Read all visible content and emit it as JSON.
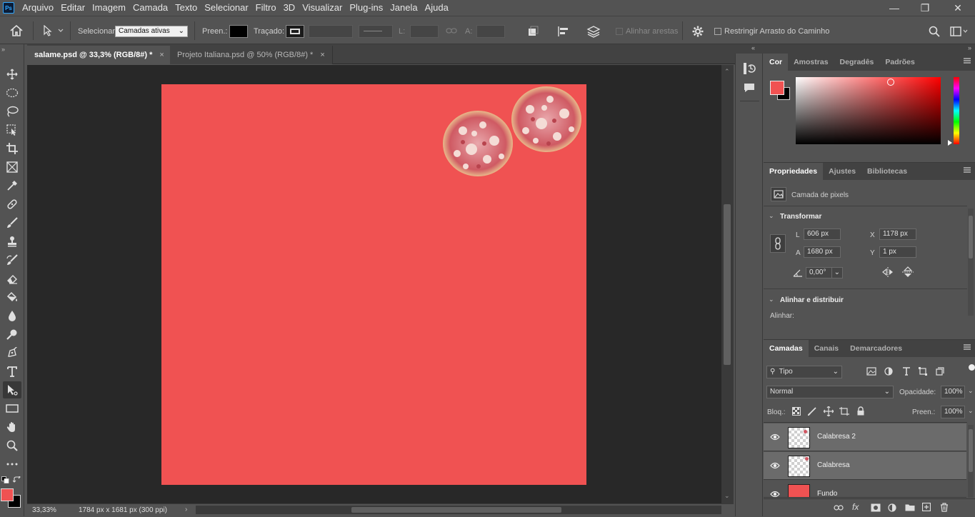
{
  "menubar": {
    "logo": "Ps",
    "items": [
      "Arquivo",
      "Editar",
      "Imagem",
      "Camada",
      "Texto",
      "Selecionar",
      "Filtro",
      "3D",
      "Visualizar",
      "Plug-ins",
      "Janela",
      "Ajuda"
    ]
  },
  "window": {
    "minimize": "—",
    "maximize": "❐",
    "close": "✕"
  },
  "options": {
    "select_label": "Selecionar:",
    "select_value": "Camadas ativas",
    "fill_label": "Preen.:",
    "stroke_label": "Traçado:",
    "width_label": "L:",
    "height_label": "A:",
    "align_edges": "Alinhar arestas",
    "constrain_path": "Restringir Arrasto do Caminho"
  },
  "tabs": [
    {
      "label": "salame.psd @ 33,3% (RGB/8#) *",
      "close": "×"
    },
    {
      "label": "Projeto Italiana.psd @ 50% (RGB/8#) *",
      "close": "×"
    }
  ],
  "status": {
    "zoom": "33,33%",
    "doc_info": "1784 px x 1681 px (300 ppi)",
    "arrow": "›"
  },
  "colors": {
    "foreground": "#f05252",
    "background": "#000000",
    "canvas": "#f05252"
  },
  "color_panel": {
    "tabs": [
      "Cor",
      "Amostras",
      "Degradês",
      "Padrões"
    ],
    "active": 0
  },
  "properties": {
    "tabs": [
      "Propriedades",
      "Ajustes",
      "Bibliotecas"
    ],
    "layer_type": "Camada de pixels",
    "transform_title": "Transformar",
    "w_label": "L",
    "w_value": "606 px",
    "h_label": "A",
    "h_value": "1680 px",
    "x_label": "X",
    "x_value": "1178 px",
    "y_label": "Y",
    "y_value": "1 px",
    "angle_value": "0,00°",
    "align_title": "Alinhar e distribuir",
    "align_label": "Alinhar:"
  },
  "layers": {
    "tabs": [
      "Camadas",
      "Canais",
      "Demarcadores"
    ],
    "filter": "Tipo",
    "blend_mode": "Normal",
    "opacity_label": "Opacidade:",
    "opacity_value": "100%",
    "lock_label": "Bloq.:",
    "fill_label": "Preen.:",
    "fill_value": "100%",
    "items": [
      {
        "name": "Calabresa 2",
        "selected": true
      },
      {
        "name": "Calabresa",
        "selected": true
      },
      {
        "name": "Fundo",
        "selected": false
      }
    ]
  }
}
